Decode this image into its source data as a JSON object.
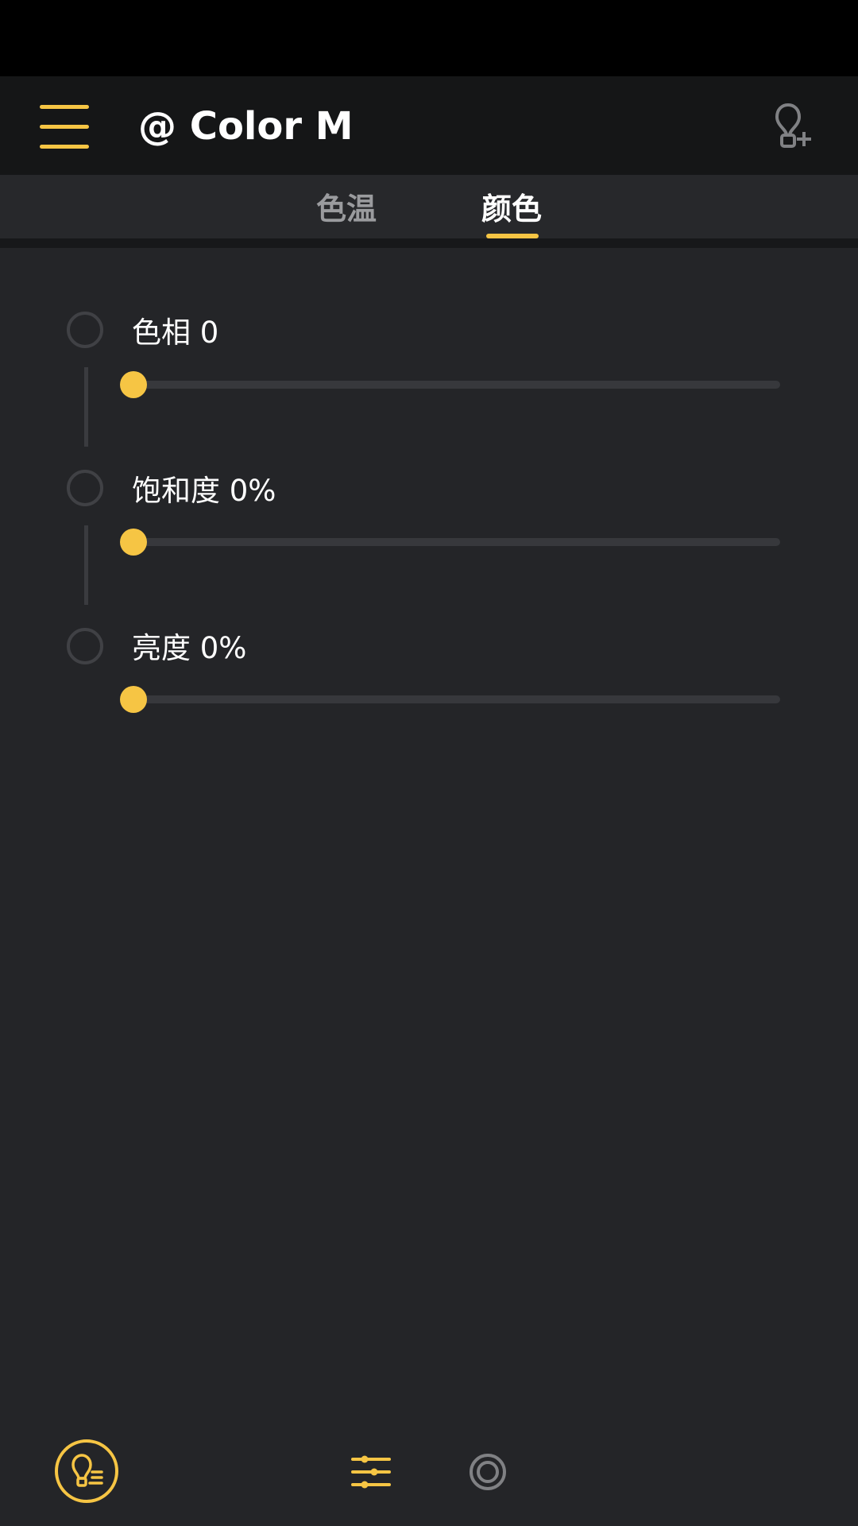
{
  "app_bar": {
    "title": "@ Color M",
    "menu_icon": "hamburger-menu-icon",
    "add_light_icon": "lightbulb-plus-icon"
  },
  "tabs": [
    {
      "label": "色温",
      "selected": false
    },
    {
      "label": "颜色",
      "selected": true
    }
  ],
  "sliders": [
    {
      "label": "色相 0",
      "value": 0
    },
    {
      "label": "饱和度 0%",
      "value": 0
    },
    {
      "label": "亮度 0%",
      "value": 0
    }
  ],
  "bottom_nav": {
    "items": [
      {
        "icon": "lightbulb-list-icon",
        "active": true
      },
      {
        "icon": "sliders-icon",
        "active": true
      },
      {
        "icon": "scene-ring-icon",
        "active": false
      }
    ]
  },
  "colors": {
    "accent": "#f6c544",
    "background": "#242528",
    "app_bar": "#151617",
    "track": "#37383c",
    "inactive_icon": "#808184"
  }
}
